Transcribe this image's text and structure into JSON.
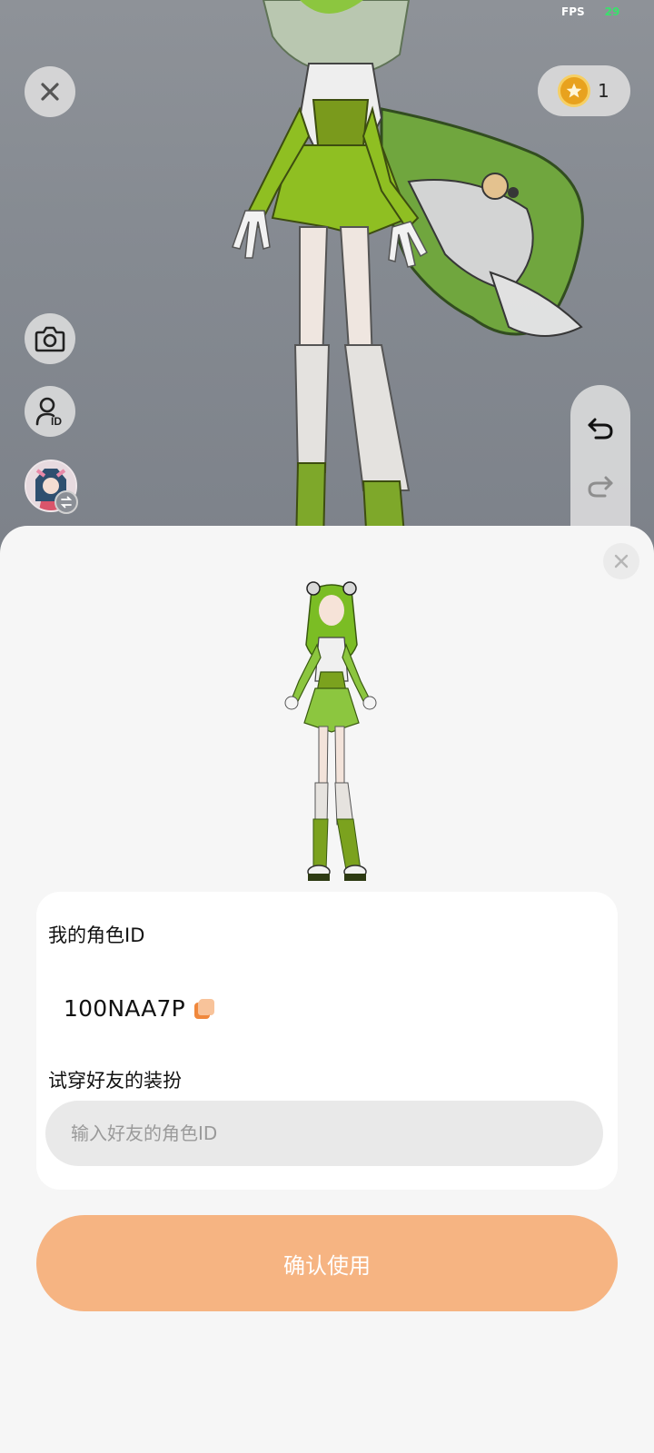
{
  "status": {
    "fps_label": "FPS",
    "fps_value": "29"
  },
  "scene": {
    "close_icon": "close-icon",
    "camera_icon": "camera-icon",
    "profile_id_icon": "profile-id-icon",
    "undo_icon": "undo-icon",
    "redo_icon": "redo-icon",
    "swap_icon": "swap-icon"
  },
  "currency": {
    "icon": "star-coin-icon",
    "count": "1"
  },
  "sheet": {
    "my_id_label": "我的角色ID",
    "my_id_value": "100NAA7P",
    "try_on_label": "试穿好友的装扮",
    "friend_input": {
      "placeholder": "输入好友的角色ID",
      "value": ""
    },
    "confirm_label": "确认使用"
  },
  "colors": {
    "accent": "#f6b482",
    "fps_value": "#39e26b",
    "coin": "#e8a21e",
    "copy_icon": "#f0883c"
  }
}
